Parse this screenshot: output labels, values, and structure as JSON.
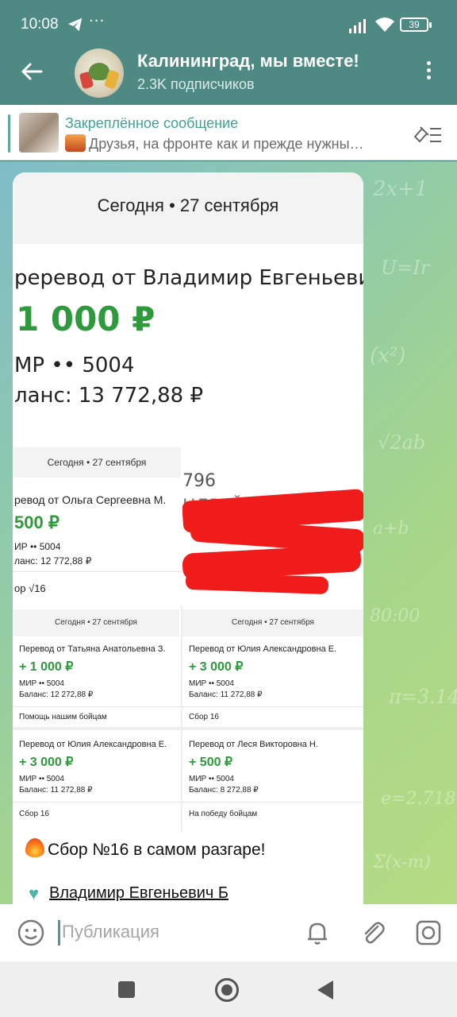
{
  "status": {
    "time": "10:08",
    "dots": "···",
    "battery": "39"
  },
  "header": {
    "title": "Калининград, мы вместе!",
    "subtitle": "2.3K подписчиков"
  },
  "pinned": {
    "title": "Закреплённое сообщение",
    "text": "Друзья, на фронте как и прежде нужны…"
  },
  "screenshot": {
    "big": {
      "date": "Сегодня • 27 сентября",
      "line": "реревод от Владимир Евгеньевич Б",
      "amount": "1 000 ₽",
      "card": "МР •• 5004",
      "balance": "ланс: 13 772,88 ₽"
    },
    "left": {
      "date": "Сегодня • 27 сентября",
      "line": "ревод от Ольга Сергеевна М.",
      "amount": "500 ₽",
      "card": "ИР •• 5004",
      "balance": "ланс: 12 772,88 ₽",
      "note": "ор √16"
    },
    "redacted": {
      "num": "796",
      "name": "НДРЕЙ"
    },
    "q1": {
      "date": "Сегодня • 27 сентября",
      "line": "Перевод от Татьяна Анатольевна З.",
      "amount": "+ 1 000 ₽",
      "card": "МИР •• 5004",
      "balance": "Баланс: 12 272,88 ₽",
      "note": "Помощь нашим бойцам"
    },
    "q2": {
      "date": "Сегодня • 27 сентября",
      "line": "Перевод от Юлия Александровна Е.",
      "amount": "+ 3 000 ₽",
      "card": "МИР •• 5004",
      "balance": "Баланс: 11 272,88 ₽",
      "note": "Сбор 16"
    },
    "q3": {
      "line": "Перевод от Юлия Александровна Е.",
      "amount": "+ 3 000 ₽",
      "card": "МИР •• 5004",
      "balance": "Баланс: 11 272,88 ₽",
      "note": "Сбор 16"
    },
    "q4": {
      "line": "Перевод от Леся Викторовна Н.",
      "amount": "+ 500 ₽",
      "card": "МИР •• 5004",
      "balance": "Баланс: 8 272,88 ₽",
      "note": "На победу бойцам"
    }
  },
  "message": {
    "line1": "Сбор №16 в самом разгаре!",
    "line2": "Владимир Евгеньевич Б"
  },
  "input": {
    "placeholder": "Публикация"
  },
  "colors": {
    "header": "#4e8a83",
    "accent": "#3ea394",
    "amount": "#2f9a3b",
    "redact": "#f01c1c"
  }
}
